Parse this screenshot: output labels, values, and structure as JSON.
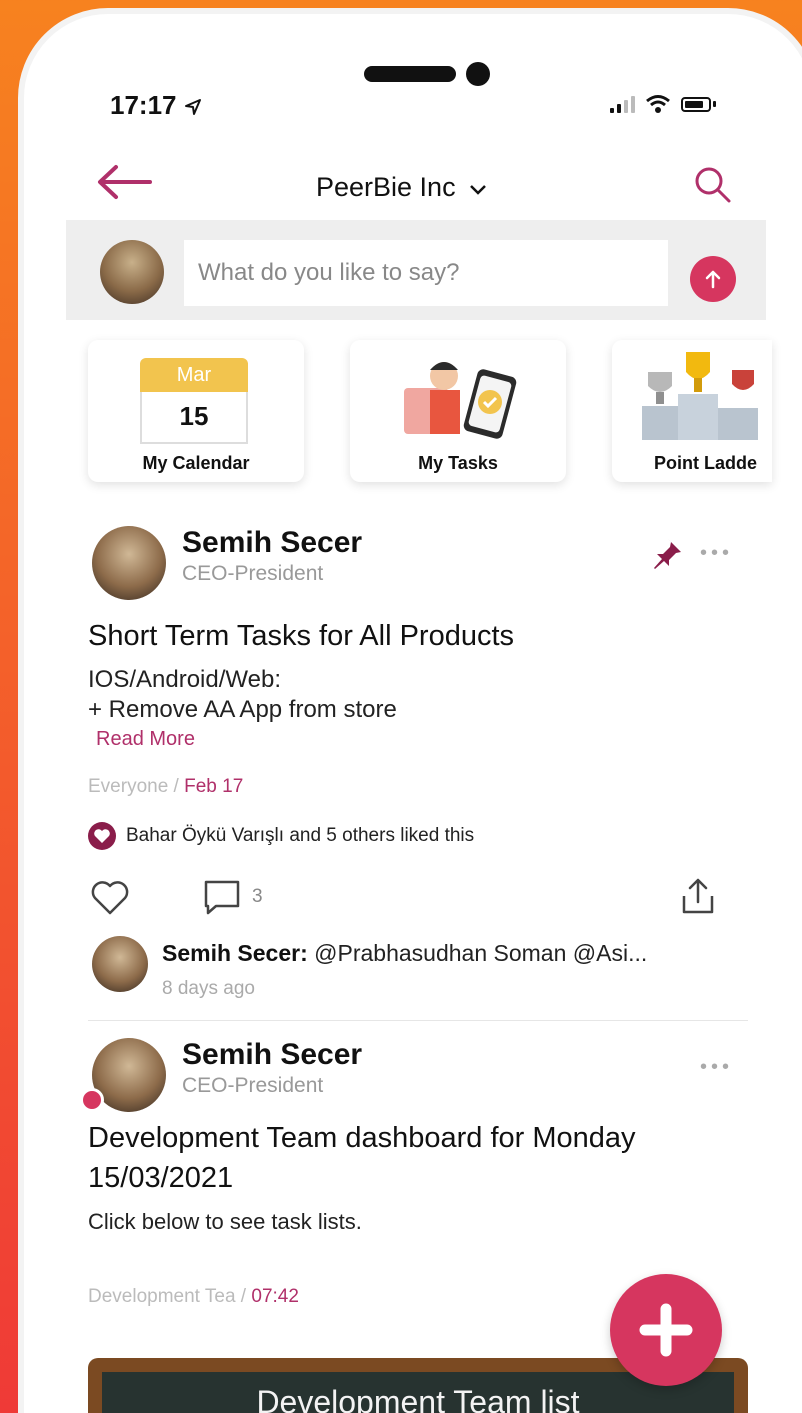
{
  "status": {
    "time": "17:17"
  },
  "nav": {
    "title": "PeerBie Inc"
  },
  "composer": {
    "placeholder": "What do you like to say?"
  },
  "quick_actions": [
    {
      "label": "My Calendar",
      "month": "Mar",
      "day": "15"
    },
    {
      "label": "My Tasks"
    },
    {
      "label": "Point Ladde"
    }
  ],
  "post1": {
    "author": "Semih Secer",
    "role": "CEO-President",
    "title": "Short Term Tasks for All Products",
    "body_line1": "IOS/Android/Web:",
    "body_line2": "+ Remove AA App from store",
    "read_more": "Read More",
    "audience": "Everyone",
    "date": "Feb 17",
    "likes_text": "Bahar Öykü Varışlı and 5 others liked this",
    "comment_count": "3",
    "comment_author": "Semih Secer:",
    "comment_text": " @Prabhasudhan Soman @Asi...",
    "comment_time": "8 days ago"
  },
  "post2": {
    "author": "Semih Secer",
    "role": "CEO-President",
    "title_line1": "Development Team dashboard for Monday",
    "title_line2": "15/03/2021",
    "body": "Click below to see task lists.",
    "audience": "Development Tea",
    "time": "07:42",
    "board_text": "Development Team list"
  },
  "colors": {
    "accent": "#d6365f",
    "accent_dark": "#8a1d4a",
    "link": "#b0306a"
  },
  "icons": [
    "back-arrow-icon",
    "search-icon",
    "send-arrow-icon",
    "pin-icon",
    "more-dots-icon",
    "heart-icon",
    "comment-icon",
    "share-icon",
    "plus-icon"
  ]
}
